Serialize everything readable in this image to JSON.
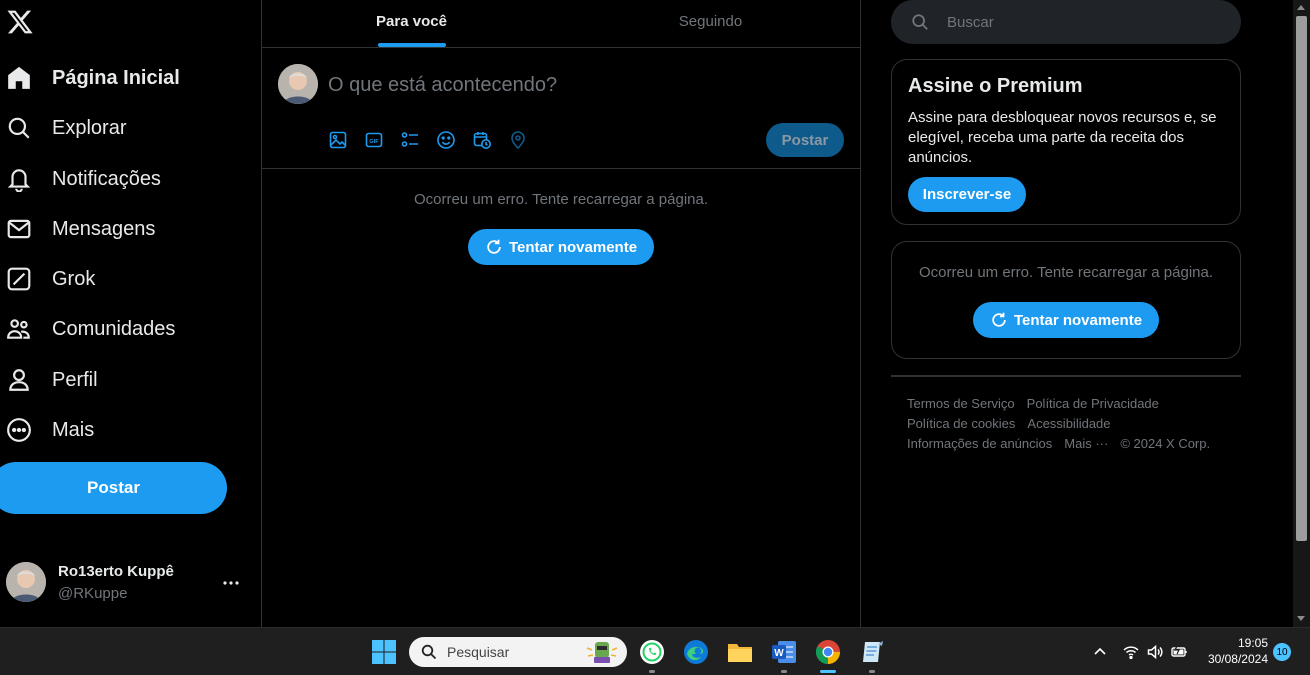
{
  "sidebar": {
    "nav": [
      {
        "label": "Página Inicial",
        "icon": "home-icon",
        "active": true
      },
      {
        "label": "Explorar",
        "icon": "search-icon"
      },
      {
        "label": "Notificações",
        "icon": "bell-icon"
      },
      {
        "label": "Mensagens",
        "icon": "envelope-icon"
      },
      {
        "label": "Grok",
        "icon": "grok-icon"
      },
      {
        "label": "Comunidades",
        "icon": "people-icon"
      },
      {
        "label": "Perfil",
        "icon": "person-icon"
      },
      {
        "label": "Mais",
        "icon": "more-circle-icon"
      }
    ],
    "post_label": "Postar",
    "profile": {
      "name": "Ro13erto Kuppê",
      "handle": "@RKuppe"
    }
  },
  "tabs": [
    {
      "label": "Para você",
      "active": true
    },
    {
      "label": "Seguindo",
      "active": false
    }
  ],
  "compose": {
    "placeholder": "O que está acontecendo?",
    "post_label": "Postar",
    "tools": [
      "image-icon",
      "gif-icon",
      "poll-icon",
      "emoji-icon",
      "schedule-icon",
      "location-icon"
    ]
  },
  "feed": {
    "error": "Ocorreu um erro. Tente recarregar a página.",
    "retry_label": "Tentar novamente"
  },
  "right": {
    "search_placeholder": "Buscar",
    "premium": {
      "title": "Assine o Premium",
      "text": "Assine para desbloquear novos recursos e, se elegível, receba uma parte da receita dos anúncios.",
      "button": "Inscrever-se"
    },
    "trends_error": "Ocorreu um erro. Tente recarregar a página.",
    "trends_retry": "Tentar novamente",
    "footer": {
      "row1": [
        "Termos de Serviço",
        "Política de Privacidade"
      ],
      "row2": [
        "Política de cookies",
        "Acessibilidade"
      ],
      "row3": [
        "Informações de anúncios",
        "Mais ···",
        "© 2024 X Corp."
      ]
    }
  },
  "taskbar": {
    "search_placeholder": "Pesquisar",
    "time": "19:05",
    "date": "30/08/2024",
    "notifications": "10"
  },
  "colors": {
    "accent": "#1d9bf0",
    "background": "#000000",
    "muted": "#71767b",
    "border": "#2f3336"
  }
}
